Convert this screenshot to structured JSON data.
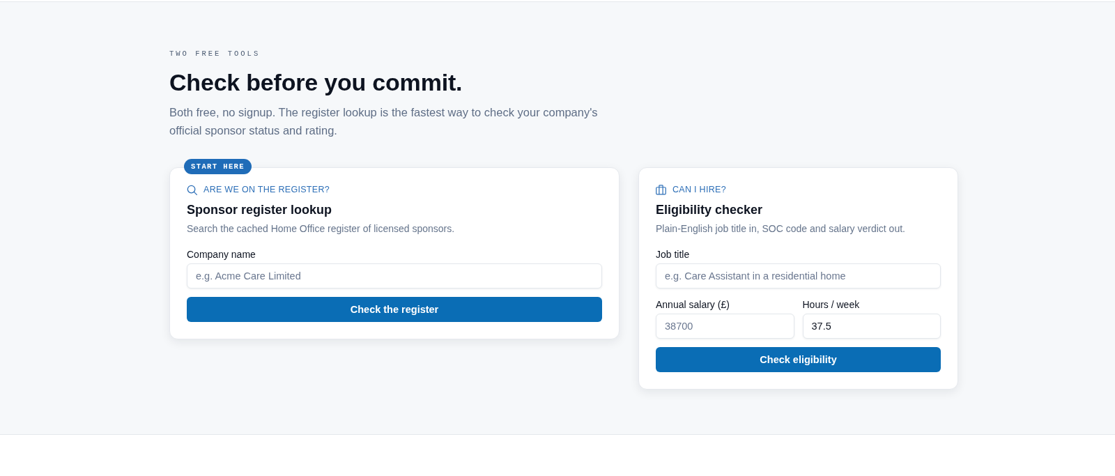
{
  "section": {
    "eyebrow": "TWO FREE TOOLS",
    "heading": "Check before you commit.",
    "intro": "Both free, no signup. The register lookup is the fastest way to check your company's official sponsor status and rating."
  },
  "cards": [
    {
      "kind": "lookup",
      "badge": "START HERE",
      "eyebrow": "ARE WE ON THE REGISTER?",
      "title": "Sponsor register lookup",
      "description": "Search the cached Home Office register of licensed sponsors.",
      "field_rows": [
        [
          {
            "label": "Company name",
            "placeholder": "e.g. Acme Care Limited"
          }
        ]
      ],
      "button": "Check the register"
    },
    {
      "kind": "eligibility",
      "eyebrow": "CAN I HIRE?",
      "title": "Eligibility checker",
      "description": "Plain-English job title in, SOC code and salary verdict out.",
      "field_rows": [
        [
          {
            "label": "Job title",
            "placeholder": "e.g. Care Assistant in a residential home"
          }
        ],
        [
          {
            "label": "Annual salary (£)",
            "placeholder": "38700"
          },
          {
            "label": "Hours / week",
            "value": "37.5"
          }
        ]
      ],
      "button": "Check eligibility"
    }
  ]
}
